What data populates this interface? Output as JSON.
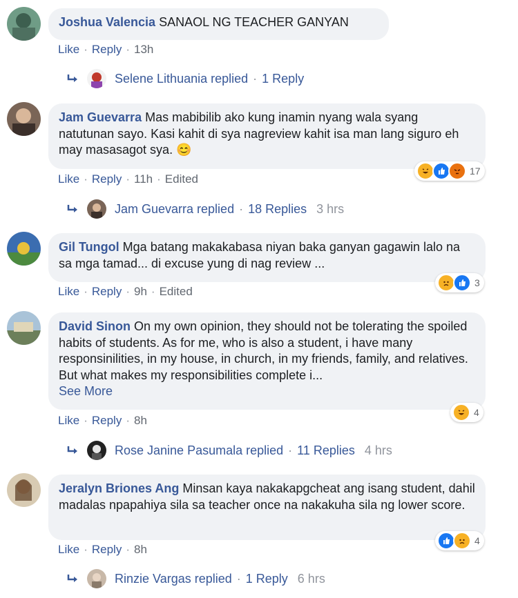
{
  "actions": {
    "like": "Like",
    "reply": "Reply",
    "edited": "Edited",
    "see_more": "See More"
  },
  "comments": [
    {
      "author": "Joshua Valencia",
      "text": "SANAOL NG TEACHER GANYAN",
      "time": "13h",
      "reply_summary": {
        "name": "Selene Lithuania replied",
        "count": "1 Reply",
        "time": ""
      }
    },
    {
      "author": "Jam Guevarra",
      "text": "Mas mabibilib ako kung inamin nyang wala syang natutunan sayo. Kasi kahit di sya nagreview kahit isa man lang siguro eh may masasagot sya. 😊",
      "time": "11h",
      "reactions": {
        "icons": [
          "haha-icon",
          "like-icon",
          "angry-icon"
        ],
        "count": "17"
      },
      "reply_summary": {
        "name": "Jam Guevarra replied",
        "count": "18 Replies",
        "time": "3 hrs"
      }
    },
    {
      "author": "Gil Tungol",
      "text": "Mga batang makakabasa niyan baka ganyan gagawin lalo na sa mga tamad... di excuse yung di nag review ...",
      "time": "9h",
      "reactions": {
        "icons": [
          "sad-icon",
          "like-icon"
        ],
        "count": "3"
      }
    },
    {
      "author": "David Sinon",
      "text": "On my own opinion, they should not be tolerating the spoiled habits of students. As for me, who is also a student, i have many responsinilities, in my house, in church, in my friends, family, and relatives. But what makes my responsibilities complete i...",
      "time": "8h",
      "reactions": {
        "icons": [
          "haha-icon"
        ],
        "count": "4"
      },
      "reply_summary": {
        "name": "Rose Janine Pasumala replied",
        "count": "11 Replies",
        "time": "4 hrs"
      }
    },
    {
      "author": "Jeralyn Briones Ang",
      "text": "Minsan kaya nakakapgcheat ang isang student, dahil madalas npapahiya sila sa teacher once na nakakuha sila ng lower score.",
      "time": "8h",
      "reactions": {
        "icons": [
          "like-icon",
          "sad-icon"
        ],
        "count": "4"
      },
      "reply_summary": {
        "name": "Rinzie Vargas replied",
        "count": "1 Reply",
        "time": "6 hrs"
      }
    }
  ],
  "colors": {
    "link": "#385898",
    "bubble": "#f0f2f5",
    "like": "#1877f2",
    "haha": "#f7b125",
    "angry": "#e9710f"
  }
}
